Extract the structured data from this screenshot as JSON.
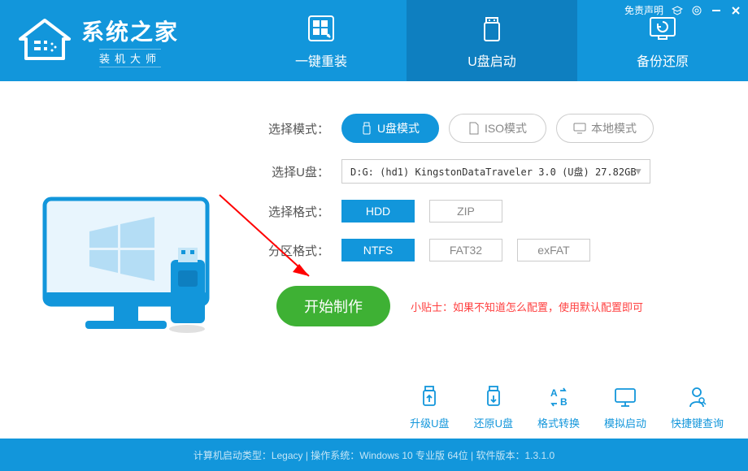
{
  "header": {
    "brand_title": "系统之家",
    "brand_sub": "装机大师",
    "disclaimer": "免责声明",
    "tabs": [
      {
        "label": "一键重装"
      },
      {
        "label": "U盘启动"
      },
      {
        "label": "备份还原"
      }
    ]
  },
  "main": {
    "mode_label": "选择模式：",
    "modes": [
      {
        "label": "U盘模式",
        "icon": "usb"
      },
      {
        "label": "ISO模式",
        "icon": "iso"
      },
      {
        "label": "本地模式",
        "icon": "monitor"
      }
    ],
    "usb_label": "选择U盘：",
    "usb_value": "D:G: (hd1) KingstonDataTraveler 3.0 (U盘) 27.82GB",
    "format_label": "选择格式：",
    "formats": [
      "HDD",
      "ZIP"
    ],
    "partition_label": "分区格式：",
    "partitions": [
      "NTFS",
      "FAT32",
      "exFAT"
    ],
    "start_label": "开始制作",
    "tip": "小贴士：如果不知道怎么配置，使用默认配置即可"
  },
  "toolbar": [
    {
      "label": "升级U盘"
    },
    {
      "label": "还原U盘"
    },
    {
      "label": "格式转换"
    },
    {
      "label": "模拟启动"
    },
    {
      "label": "快捷键查询"
    }
  ],
  "footer": {
    "text": "计算机启动类型：Legacy | 操作系统：Windows 10 专业版 64位 | 软件版本：1.3.1.0"
  }
}
